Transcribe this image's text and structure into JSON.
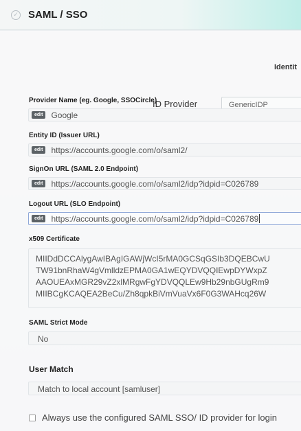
{
  "header": {
    "title": "SAML / SSO"
  },
  "identity_label": "Identit",
  "id_provider": {
    "label": "ID Provider",
    "value": "GenericIDP"
  },
  "edit_tag": "edit",
  "fields": [
    {
      "label": "Provider Name (eg. Google, SSOCircle)",
      "value": "Google"
    },
    {
      "label": "Entity ID (Issuer URL)",
      "value": "https://accounts.google.com/o/saml2/"
    },
    {
      "label": "SignOn URL (SAML 2.0 Endpoint)",
      "value": "https://accounts.google.com/o/saml2/idp?idpid=C026789"
    },
    {
      "label": "Logout URL (SLO Endpoint)",
      "value": "https://accounts.google.com/o/saml2/idp?idpid=C026789"
    }
  ],
  "certificate": {
    "label": "x509 Certificate",
    "lines": [
      "MIIDdDCCAlygAwIBAgIGAWjWcI5rMA0GCSqGSIb3DQEBCwU",
      "TW91bnRhaW4gVmlldzEPMA0GA1wEQYDVQQIEwpDYWxpZ",
      "AAOUEAxMGR29vZ2xlMRgwFgYDVQQLEw9Hb29nbGUgRm9",
      "MIIBCgKCAQEA2BeCu/Zh8qpkBiVmVuaVx6F0G3WAHcq26W"
    ]
  },
  "strict_mode": {
    "label": "SAML Strict Mode",
    "value": "No"
  },
  "user_match": {
    "title": "User Match",
    "value": "Match to local account [samluser]"
  },
  "always_use": {
    "label": "Always use the configured SAML SSO/ ID provider for login"
  }
}
